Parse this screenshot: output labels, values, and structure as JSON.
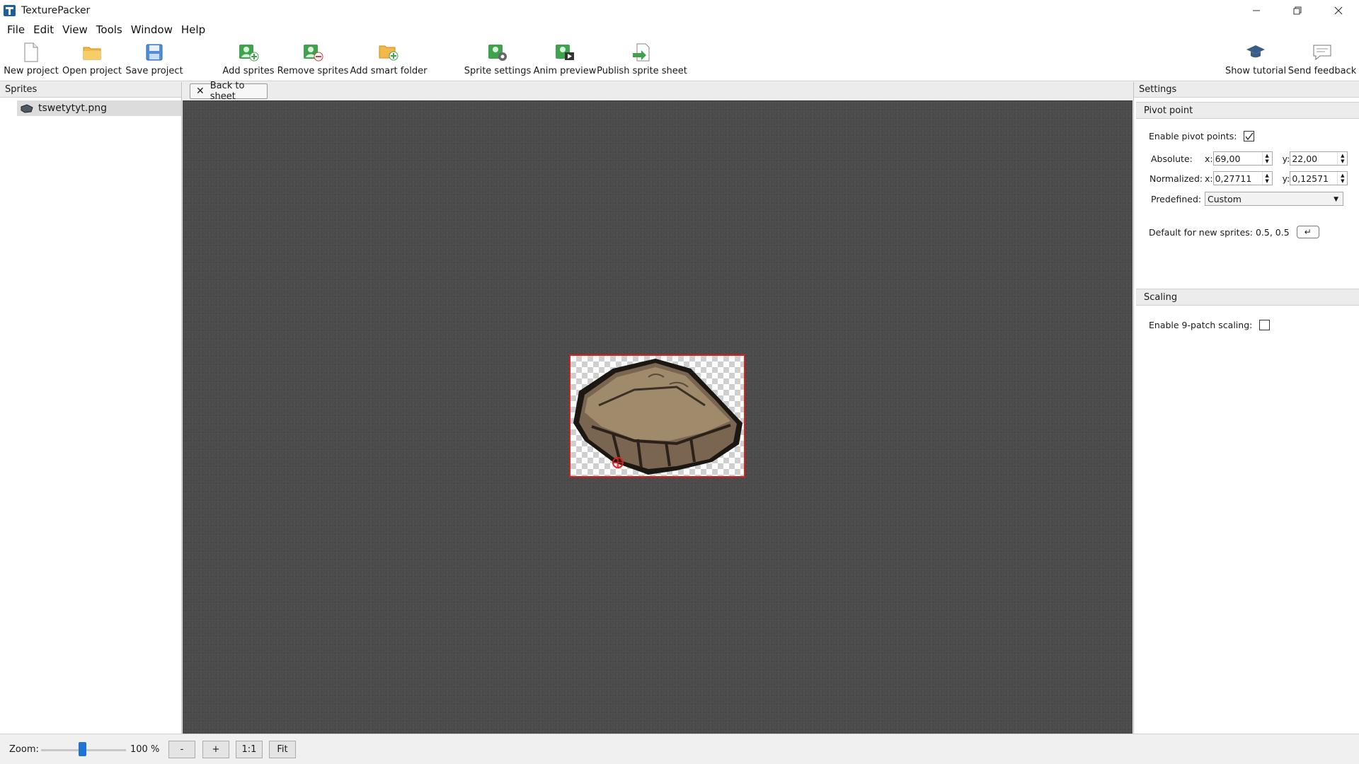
{
  "window": {
    "title": "TexturePacker",
    "minimize_icon": "minimize-icon",
    "maximize_icon": "restore-icon",
    "close_icon": "close-icon"
  },
  "menu": [
    "File",
    "Edit",
    "View",
    "Tools",
    "Window",
    "Help"
  ],
  "toolbar": {
    "new_project": "New project",
    "open_project": "Open project",
    "save_project": "Save project",
    "add_sprites": "Add sprites",
    "remove_sprites": "Remove sprites",
    "add_smart_folder": "Add smart folder",
    "sprite_settings": "Sprite settings",
    "anim_preview": "Anim preview",
    "publish_sprite_sheet": "Publish sprite sheet",
    "show_tutorial": "Show tutorial",
    "send_feedback": "Send feedback"
  },
  "sprites_panel": {
    "title": "Sprites",
    "items": [
      {
        "name": "tswetytyt.png"
      }
    ]
  },
  "center": {
    "back_button": "Back to sheet"
  },
  "settings_panel": {
    "title": "Settings",
    "pivot_section": "Pivot point",
    "enable_pivot_label": "Enable pivot points:",
    "enable_pivot_checked": true,
    "absolute_label": "Absolute:",
    "abs_x_label": "x:",
    "abs_x": "69,00",
    "abs_y_label": "y:",
    "abs_y": "22,00",
    "normalized_label": "Normalized:",
    "norm_x_label": "x:",
    "norm_x": "0,27711",
    "norm_y_label": "y:",
    "norm_y": "0,12571",
    "predefined_label": "Predefined:",
    "predefined_value": "Custom",
    "default_label": "Default for new sprites: 0.5, 0.5",
    "default_button": "↵",
    "scaling_section": "Scaling",
    "enable_9patch_label": "Enable 9-patch scaling:",
    "enable_9patch_checked": false
  },
  "statusbar": {
    "zoom_label": "Zoom:",
    "zoom_value": "100 %",
    "zoom_level": 100,
    "minus": "-",
    "plus": "+",
    "one_to_one": "1:1",
    "fit": "Fit"
  },
  "colors": {
    "accent": "#1e74d6",
    "canvas_bg": "#4b4b4b",
    "frame_border": "#e01d1d"
  }
}
